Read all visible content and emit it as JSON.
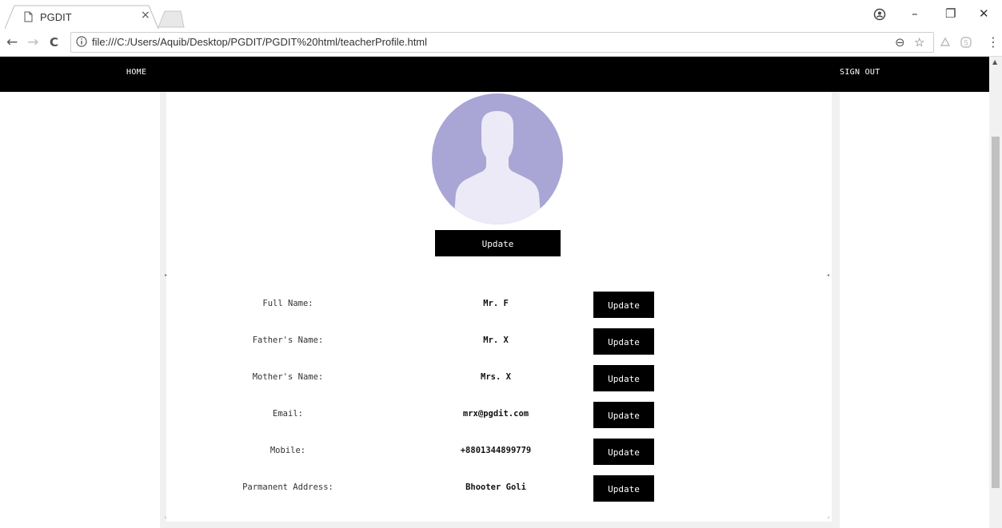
{
  "browser": {
    "tab_title": "PGDIT",
    "tab_close": "×",
    "url": "file:///C:/Users/Aquib/Desktop/PGDIT/PGDIT%20html/teacherProfile.html",
    "back": "←",
    "forward": "→",
    "reload": "C",
    "minimize": "–",
    "restore": "❐",
    "close": "✕",
    "zoom_icon": "⊖",
    "star_icon": "☆",
    "menu_icon": "⋮"
  },
  "nav": {
    "home": "HOME",
    "signout": "SIGN OUT"
  },
  "profile": {
    "photo_update": "Update",
    "rows": [
      {
        "label": "Full Name:",
        "value": "Mr. F",
        "button": "Update"
      },
      {
        "label": "Father's Name:",
        "value": "Mr. X",
        "button": "Update"
      },
      {
        "label": "Mother's Name:",
        "value": "Mrs. X",
        "button": "Update"
      },
      {
        "label": "Email:",
        "value": "mrx@pgdit.com",
        "button": "Update"
      },
      {
        "label": "Mobile:",
        "value": "+8801344899779",
        "button": "Update"
      },
      {
        "label": "Parmanent Address:",
        "value": "Bhooter Goli",
        "button": "Update"
      }
    ]
  },
  "colors": {
    "navbar": "#000000",
    "avatar_bg": "#a9a6d5",
    "avatar_figure": "#ebeaf6",
    "button_bg": "#000000",
    "button_text": "#ffffff"
  }
}
